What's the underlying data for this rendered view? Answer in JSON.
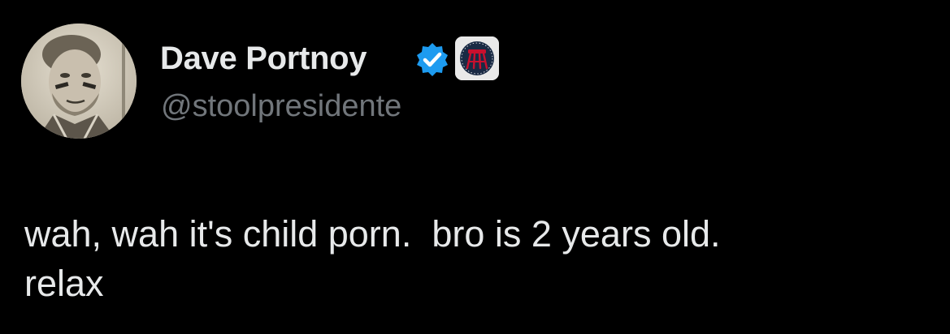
{
  "author": {
    "display_name": "Dave Portnoy",
    "handle": "@stoolpresidente",
    "verified_icon": "verified-check-icon",
    "affiliate_badge_icon": "barstool-logo-icon",
    "verified_color": "#1d9bf0"
  },
  "tweet": {
    "text": "wah, wah it's child porn.  bro is 2 years old.\nrelax"
  },
  "colors": {
    "background": "#000000",
    "primary_text": "#e7e9ea",
    "secondary_text": "#71767b"
  }
}
